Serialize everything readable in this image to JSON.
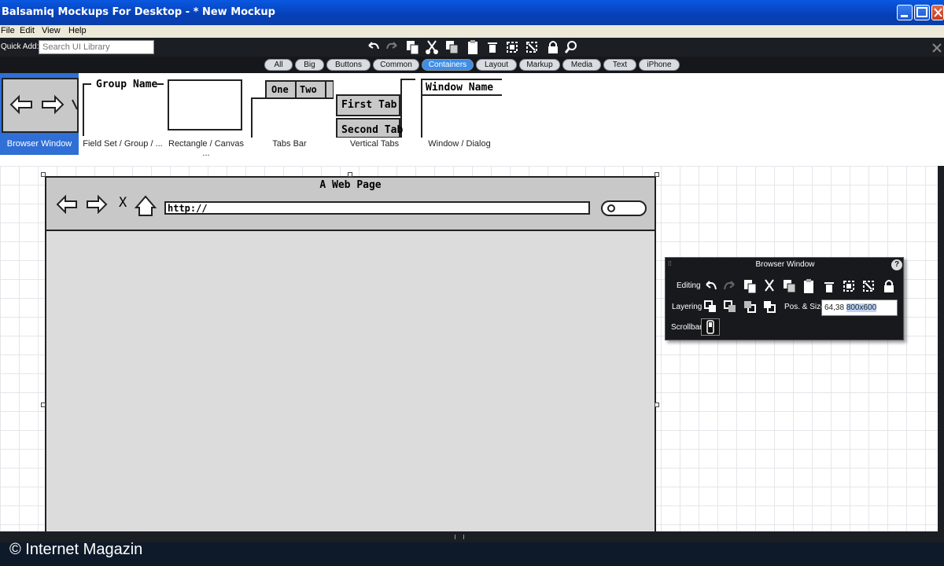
{
  "window": {
    "title": "Balsamiq Mockups For Desktop - * New Mockup"
  },
  "menu": [
    "File",
    "Edit",
    "View",
    "Help"
  ],
  "toolbar": {
    "quick_add_label": "Quick Add:",
    "search_placeholder": "Search UI Library"
  },
  "filters": {
    "items": [
      "All",
      "Big",
      "Buttons",
      "Common",
      "Containers",
      "Layout",
      "Markup",
      "Media",
      "Text",
      "iPhone"
    ],
    "active": "Containers"
  },
  "library": {
    "items": [
      {
        "label": "Browser Window",
        "selected": true
      },
      {
        "label": "Field Set / Group / ...",
        "selected": false
      },
      {
        "label": "Rectangle / Canvas ...",
        "selected": false
      },
      {
        "label": "Tabs Bar",
        "selected": false
      },
      {
        "label": "Vertical Tabs",
        "selected": false
      },
      {
        "label": "Window / Dialog",
        "selected": false
      }
    ],
    "previews": {
      "group_name": "Group Name",
      "tab_one": "One",
      "tab_two": "Two",
      "first_tab": "First Tab",
      "second_tab": "Second Tab",
      "window_name": "Window Name"
    }
  },
  "mockup": {
    "title": "A Web Page",
    "url": "http://",
    "stop_glyph": "X"
  },
  "properties": {
    "title": "Browser Window",
    "editing_label": "Editing",
    "layering_label": "Layering",
    "pos_size_label": "Pos. & Size:",
    "position": "64,38",
    "size": "800x600",
    "scrollbar_label": "Scrollbar",
    "help_glyph": "?"
  },
  "watermark": "© Internet Magazin",
  "colors": {
    "accent": "#3f8ee6",
    "titlebar": "#0a58e0",
    "dark_ui": "#1b1e23",
    "selection": "#2f6fd6"
  }
}
